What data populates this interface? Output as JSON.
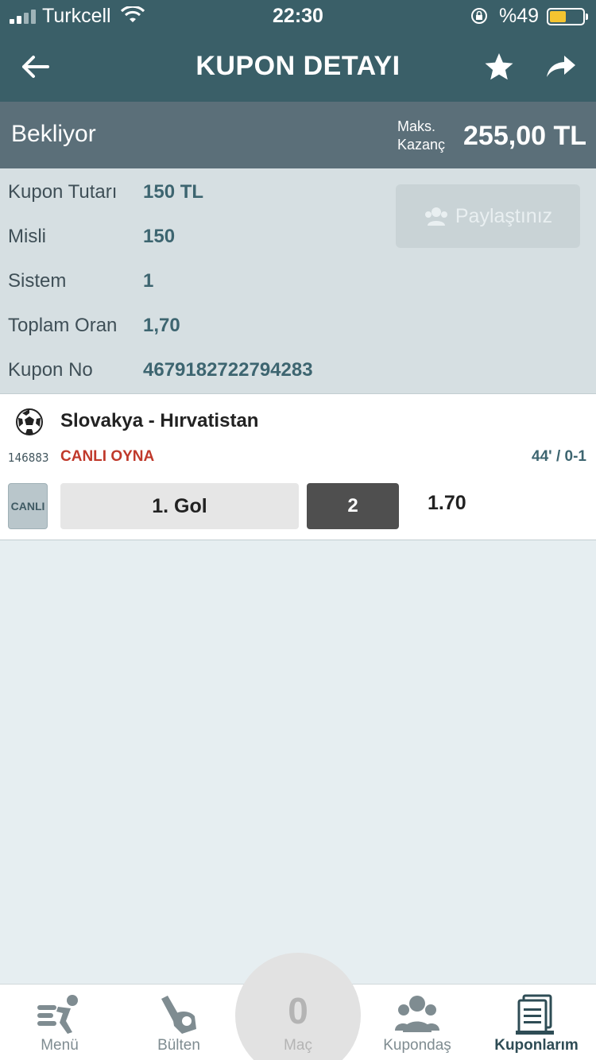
{
  "status_bar": {
    "carrier": "Turkcell",
    "time": "22:30",
    "battery_percent": "%49",
    "battery_level": 0.49
  },
  "nav": {
    "title": "KUPON DETAYI"
  },
  "summary": {
    "state": "Bekliyor",
    "max_label_line1": "Maks.",
    "max_label_line2": "Kazanç",
    "max_amount": "255,00 TL"
  },
  "details": {
    "rows": [
      {
        "label": "Kupon Tutarı",
        "value": "150 TL"
      },
      {
        "label": "Misli",
        "value": "150"
      },
      {
        "label": "Sistem",
        "value": "1"
      },
      {
        "label": "Toplam Oran",
        "value": "1,70"
      },
      {
        "label": "Kupon No",
        "value": "4679182722794283"
      }
    ],
    "share_label": "Paylaştınız"
  },
  "match": {
    "teams": "Slovakya - Hırvatistan",
    "code": "146883",
    "live_play": "CANLI OYNA",
    "score": "44' / 0-1",
    "badge": "CANLI",
    "market": "1. Gol",
    "pick": "2",
    "odd": "1.70"
  },
  "tabs": [
    {
      "label": "Menü",
      "icon": "menu-runner-icon"
    },
    {
      "label": "Bülten",
      "icon": "bulletin-hand-icon"
    },
    {
      "label": "Maç",
      "count": "0"
    },
    {
      "label": "Kupondaş",
      "icon": "community-icon"
    },
    {
      "label": "Kuponlarım",
      "icon": "coupons-icon",
      "active": true
    }
  ]
}
